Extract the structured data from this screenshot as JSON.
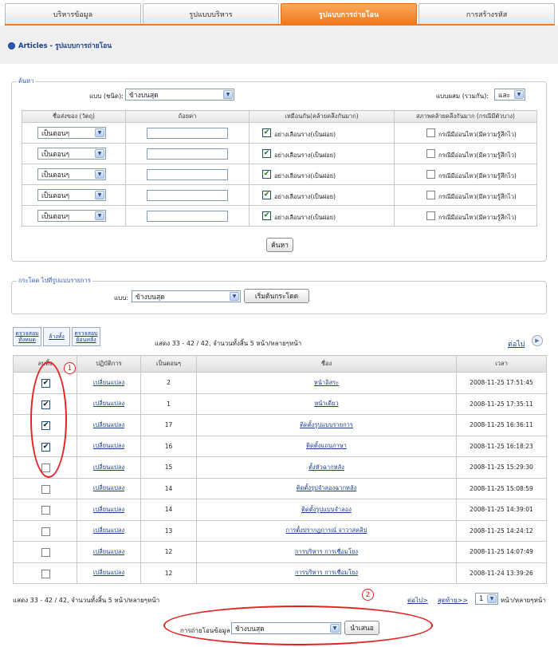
{
  "tabs": [
    {
      "label": "บริหารข้อมูล",
      "active": false
    },
    {
      "label": "รูปแบบบริหาร",
      "active": false
    },
    {
      "label": "รูปแบบการถ่ายโอน",
      "active": true
    },
    {
      "label": "การสร้างรหัส",
      "active": false
    }
  ],
  "breadcrumb": "Articles - รูปแบบการถ่ายโอน",
  "search": {
    "legend": "ค้นหา",
    "type_label": "แบบ (ชนิด):",
    "type_value": "ข้างบนสุด",
    "combine_label": "แบบผสม (รวมกัน):",
    "combine_value": "และ",
    "headers": [
      "ชื่อส่งของ (วัตถุ)",
      "ถ้อยค่า",
      "เหมือนกัน(คล้ายคลึงกันมาก)",
      "สภาพคล้ายคลึงกันมาก (กรณีมีตัวบาง)"
    ],
    "rows": [
      {
        "field": "เป็นตอนๆ",
        "value": "",
        "like_label": "อย่างเลือนราง(เป็นฝอย)",
        "like_checked": true,
        "case_label": "กรณีมีอ่อนไหว(มีความรู้สึกไว)",
        "case_checked": false
      },
      {
        "field": "เป็นตอนๆ",
        "value": "",
        "like_label": "อย่างเลือนราง(เป็นฝอย)",
        "like_checked": true,
        "case_label": "กรณีมีอ่อนไหว(มีความรู้สึกไว)",
        "case_checked": false
      },
      {
        "field": "เป็นตอนๆ",
        "value": "",
        "like_label": "อย่างเลือนราง(เป็นฝอย)",
        "like_checked": true,
        "case_label": "กรณีมีอ่อนไหว(มีความรู้สึกไว)",
        "case_checked": false
      },
      {
        "field": "เป็นตอนๆ",
        "value": "",
        "like_label": "อย่างเลือนราง(เป็นฝอย)",
        "like_checked": true,
        "case_label": "กรณีมีอ่อนไหว(มีความรู้สึกไว)",
        "case_checked": false
      },
      {
        "field": "เป็นตอนๆ",
        "value": "",
        "like_label": "อย่างเลือนราง(เป็นฝอย)",
        "like_checked": true,
        "case_label": "กรณีมีอ่อนไหว(มีความรู้สึกไว)",
        "case_checked": false
      }
    ],
    "button": "ค้นหา"
  },
  "jump": {
    "legend": "กระโดด ไปที่รูปแบบรายการ",
    "label": "แบบ:",
    "value": "ข้างบนสุด",
    "button": "เริ่มต้นกระโดด"
  },
  "tools": [
    "ตรวจสอบทั้งหมด",
    "ล้างทั้ง",
    "ตรวจสอบย้อนหลัง"
  ],
  "pager_text": "แสดง 33 - 42 / 42, จำนวนทั้งสิ้น 5 หน้า/หลายๆหน้า",
  "next_link": "ต่อไป",
  "results": {
    "headers": [
      "ลบทิ้ง",
      "ปฏิบัติการ",
      "เป็นตอนๆ",
      "ชื่อง",
      "เวลา"
    ],
    "rows": [
      {
        "checked": true,
        "action": "เปลี่ยนแปลง",
        "seq": "2",
        "name": "หน้าอิสระ",
        "time": "2008-11-25 17:51:45"
      },
      {
        "checked": true,
        "action": "เปลี่ยนแปลง",
        "seq": "1",
        "name": "หน้าเดี่ยว",
        "time": "2008-11-25 17:35:11"
      },
      {
        "checked": true,
        "action": "เปลี่ยนแปลง",
        "seq": "17",
        "name": "ติดตั้งรูปแบบรายการ",
        "time": "2008-11-25 16:36:11"
      },
      {
        "checked": true,
        "action": "เปลี่ยนแปลง",
        "seq": "16",
        "name": "ติดตั้งแถบภาษา",
        "time": "2008-11-25 16:18:23"
      },
      {
        "checked": false,
        "action": "เปลี่ยนแปลง",
        "seq": "15",
        "name": "ตั้งหัวฉากหลัง",
        "time": "2008-11-25 15:29:30"
      },
      {
        "checked": false,
        "action": "เปลี่ยนแปลง",
        "seq": "14",
        "name": "ติดตั้งรูปจำลองฉากหลัง",
        "time": "2008-11-25 15:08:59"
      },
      {
        "checked": false,
        "action": "เปลี่ยนแปลง",
        "seq": "14",
        "name": "ติดตั้งรูปแบบจำลอง",
        "time": "2008-11-25 14:39:01"
      },
      {
        "checked": false,
        "action": "เปลี่ยนแปลง",
        "seq": "13",
        "name": "การตั้งปรากฏการณ์ จาวาสคลิป",
        "time": "2008-11-25 14:24:12"
      },
      {
        "checked": false,
        "action": "เปลี่ยนแปลง",
        "seq": "12",
        "name": "การบริหาร การเชื่อมโยง",
        "time": "2008-11-25 14:07:49"
      },
      {
        "checked": false,
        "action": "เปลี่ยนแปลง",
        "seq": "12",
        "name": "การบริหาร การเชื่อมโยง",
        "time": "2008-11-24 13:39:26"
      }
    ]
  },
  "bottom": {
    "pager_text": "แสดง 33 - 42 / 42, จำนวนทั้งสิ้น 5 หน้า/หลายๆหน้า",
    "next_link": "ต่อไป>",
    "last_link": "สุดท้าย>>",
    "page_value": "1",
    "page_suffix": "หน้า/หลายๆหน้า",
    "submit_label": "การถ่ายโอนข้อมูล",
    "submit_value": "ข้างบนสุด",
    "submit_button": "นำเสนอ"
  },
  "annotations": [
    "1",
    "2"
  ],
  "colors": {
    "accent": "#f07a1c",
    "link": "#1a3d8f",
    "annotation": "#e32222"
  }
}
